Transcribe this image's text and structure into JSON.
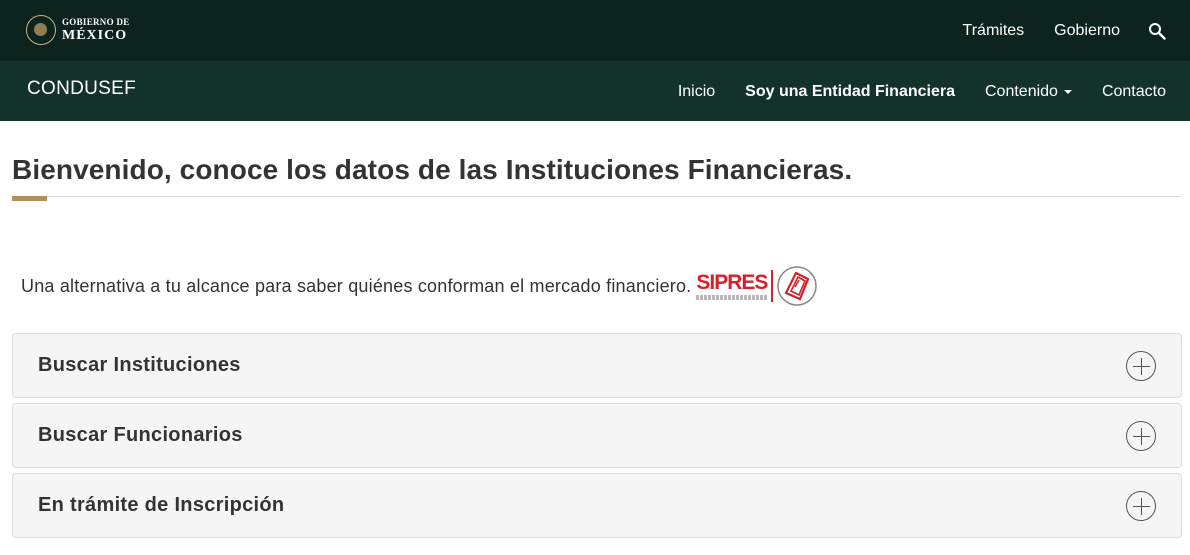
{
  "gov_header": {
    "logo_top": "GOBIERNO DE",
    "logo_bottom": "MÉXICO",
    "nav": [
      "Trámites",
      "Gobierno"
    ],
    "search_icon": "search-icon"
  },
  "site_header": {
    "brand": "CONDUSEF",
    "nav": [
      {
        "label": "Inicio"
      },
      {
        "label": "Soy una Entidad Financiera"
      },
      {
        "label": "Contenido"
      },
      {
        "label": "Contacto"
      }
    ]
  },
  "main": {
    "title": "Bienvenido, conoce los datos de las Instituciones Financieras.",
    "intro": "Una alternativa a tu alcance para saber quiénes conforman el mercado financiero.",
    "sipres_logo": "SIPRES",
    "accordion": [
      {
        "label": "Buscar Instituciones"
      },
      {
        "label": "Buscar Funcionarios"
      },
      {
        "label": "En trámite de Inscripción"
      }
    ]
  },
  "colors": {
    "gov_bar": "#0c231e",
    "site_bar": "#13322b",
    "accent_gold": "#b38e5d",
    "sipres_red": "#d6202b",
    "panel_bg": "#f5f5f5"
  }
}
